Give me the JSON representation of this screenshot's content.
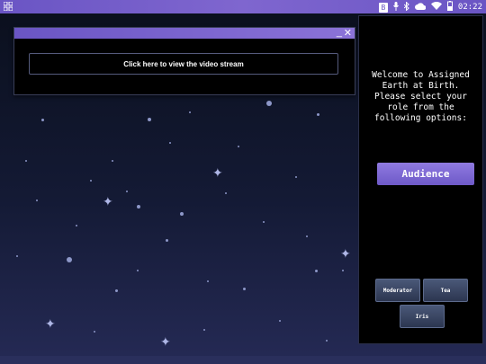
{
  "status_bar": {
    "time": "02:22",
    "icons": [
      "grid-icon",
      "document-icon",
      "microphone-icon",
      "bluetooth-icon",
      "cloud-icon",
      "wifi-icon",
      "battery-icon"
    ]
  },
  "video_window": {
    "minimize_label": "_",
    "close_label": "✕",
    "stream_button_label": "Click here to view the video stream"
  },
  "role_panel": {
    "welcome_text": "Welcome to Assigned Earth at Birth. Please select your role from the following options:",
    "audience_label": "Audience",
    "roles": [
      "Moderator",
      "Tea",
      "Iris"
    ]
  },
  "colors": {
    "accent": "#7a62d3",
    "role_button": "#3c4866",
    "background_top": "#0a0f1c",
    "background_bottom": "#252a55"
  }
}
